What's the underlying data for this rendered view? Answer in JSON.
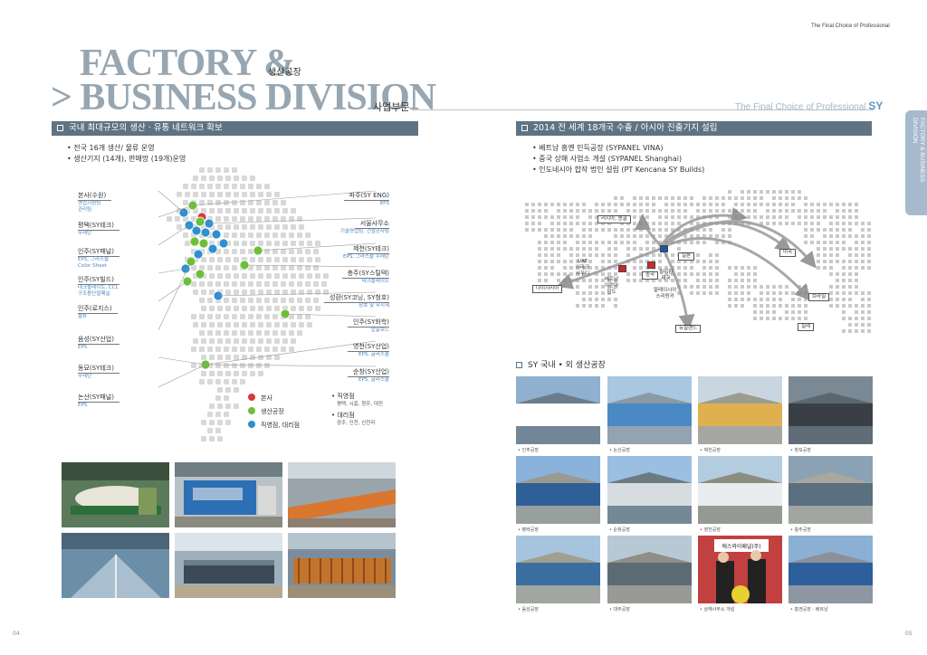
{
  "header": {
    "tagline_top": "The Final Choice of Professional",
    "title_line1": "FACTORY &",
    "title_line2": "> BUSINESS DIVISION",
    "subtitle1": "생산공장",
    "subtitle2": "사업부문",
    "tagline_right": "The Final Choice of Professional",
    "tagline_brand": "SY"
  },
  "side_tab": {
    "text": "FACTORY & BUSINESS DIVISION",
    "color": "#a7bacd"
  },
  "colors": {
    "bar": "#5e7383",
    "title": "#97a6b0",
    "hq_dot": "#d93a3a",
    "factory_dot": "#6dbf3a",
    "office_dot": "#2f8fd0",
    "map_dot": "#d8d8d8"
  },
  "domestic": {
    "bar_title": "국내 최대규모의 생산 · 유통 네트워크 확보",
    "bullets": [
      "• 전국 16개 생산/ 물류 운영",
      "• 생산기지 (14개), 판매망 (19개)운영"
    ],
    "left_locations": [
      {
        "name": "본사(수원)",
        "desc": [
          "영업지원팀",
          "관리팀"
        ]
      },
      {
        "name": "평택(SY테크)",
        "desc": [
          "우레탄"
        ]
      },
      {
        "name": "인주(SY패널)",
        "desc": [
          "EPS, 그라스울",
          "Color Sheet"
        ]
      },
      {
        "name": "인주(SY빌드)",
        "desc": [
          "데크플레이트, CCL",
          "구조용단열패널"
        ]
      },
      {
        "name": "인주(로지스)",
        "desc": [
          "물류"
        ]
      },
      {
        "name": "음성(SY산업)",
        "desc": [
          "EPS"
        ]
      },
      {
        "name": "동묘(SY테크)",
        "desc": [
          "우레탄"
        ]
      },
      {
        "name": "논산(SY패널)",
        "desc": [
          "EPS"
        ]
      }
    ],
    "right_locations": [
      {
        "name": "파주(SY ENG)",
        "desc": [
          "EPS"
        ]
      },
      {
        "name": "서울사무소",
        "desc": [
          "기술영업팀, 건설공사팀"
        ]
      },
      {
        "name": "제천(SY테크)",
        "desc": [
          "EPS, 그라스울 우레탄"
        ]
      },
      {
        "name": "충주(SY스틸텍)",
        "desc": [
          "데크플레이트"
        ]
      },
      {
        "name": "성환(SY코닝, SY청호)",
        "desc": [
          "창호 및 무지재"
        ]
      },
      {
        "name": "인주(SY화학)",
        "desc": [
          "압출보드"
        ]
      },
      {
        "name": "영천(SY산업)",
        "desc": [
          "EPS, 글라스울"
        ]
      },
      {
        "name": "순창(SY산업)",
        "desc": [
          "EPS, 글라스울"
        ]
      }
    ],
    "legend": {
      "hq": "본사",
      "factory": "생산공장",
      "office": "직영점, 대리점",
      "direct_title": "• 직영점",
      "direct_list": "평택, 시흥, 청주, 대전",
      "agency_title": "• 대리점",
      "agency_list": "광주, 인천, 신천리"
    }
  },
  "global": {
    "bar_title": "2014 전 세계 18개국 수출 / 아시아 진출기지 설립",
    "bullets": [
      "• 베트남 흥옌 민득공장 (SYPANEL VINA)",
      "• 중국 상해 사업소 개설 (SYPANEL Shanghai)",
      "• 인도네시아 합작 법인 설립 (PT Kencana SY Builds)"
    ],
    "labels": {
      "russia": "러시아, 몽골",
      "uae": [
        "UAE",
        "이라크",
        "사우디"
      ],
      "nigeria": "나이지리아",
      "vietnam": [
        "베트남",
        "이란아",
        "인도"
      ],
      "china": "중국",
      "philippines": [
        "필리핀",
        "태국"
      ],
      "malaysia": [
        "말레이시아",
        "스리랑카"
      ],
      "japan": "일본",
      "usa": "미국",
      "brazil": "브라질",
      "chile": "칠레",
      "nz": "뉴질랜드"
    }
  },
  "factories": {
    "title": "SY 국내 • 외 생산공장",
    "captions": [
      "• 인주공장",
      "• 논산공장",
      "• 제천공장",
      "• 창포공장",
      "• 평택공장",
      "• 순창공장",
      "• 영천공장",
      "• 충주공장",
      "• 음성공장",
      "• 대주공장",
      "• 상해사무소 개설",
      "• 흥옌공장 - 베트남"
    ],
    "sign_text": "에스와이패널(주)"
  },
  "pages": {
    "left": "04",
    "right": "05"
  }
}
